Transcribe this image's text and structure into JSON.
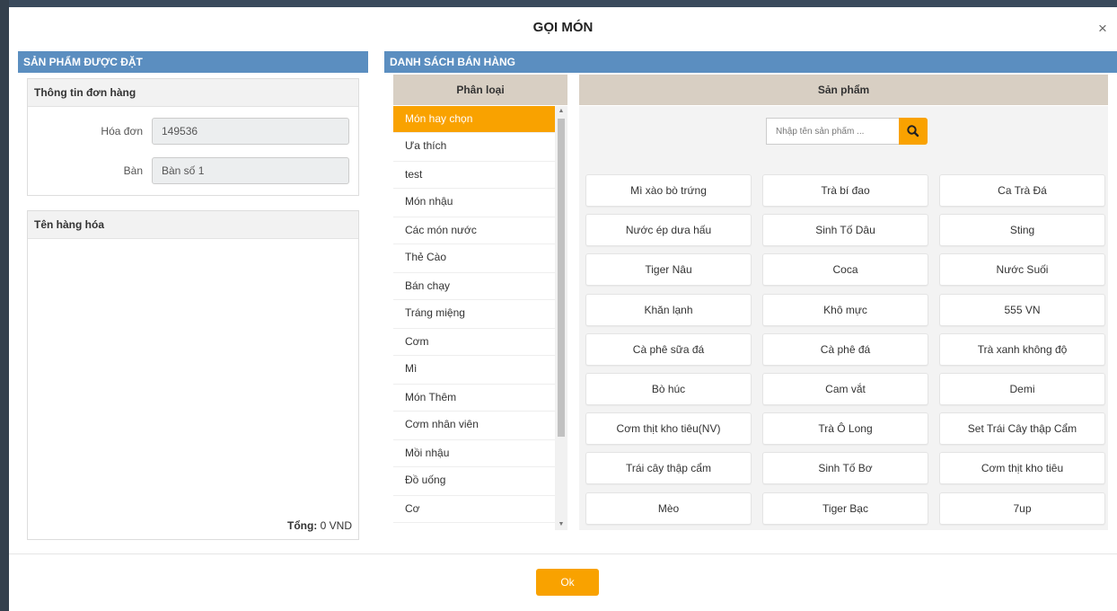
{
  "modal": {
    "title": "GỌI MÓN",
    "close_label": "×"
  },
  "left_panel": {
    "header": "SẢN PHẨM ĐƯỢC ĐẶT",
    "order_info": {
      "title": "Thông tin đơn hàng",
      "invoice_label": "Hóa đơn",
      "invoice_value": "149536",
      "table_label": "Bàn",
      "table_value": "Bàn số 1"
    },
    "items": {
      "title": "Tên hàng hóa",
      "total_label": "Tổng:",
      "total_value": "0 VND"
    }
  },
  "right_panel": {
    "header": "DANH SÁCH BÁN HÀNG",
    "category_header": "Phân loại",
    "product_header": "Sản phẩm",
    "search_placeholder": "Nhập tên sản phẩm ...",
    "categories": [
      "Món hay chọn",
      "Ưa thích",
      "test",
      "Món nhậu",
      "Các món nước",
      "Thẻ Cào",
      "Bán chạy",
      "Tráng miệng",
      "Cơm",
      "Mì",
      "Món Thêm",
      "Cơm nhân viên",
      "Mồi nhậu",
      "Đồ uống",
      "Cơ"
    ],
    "active_category": 0,
    "products": [
      "Mì xào bò trứng",
      "Trà bí đao",
      "Ca Trà Đá",
      "Nước ép dưa hấu",
      "Sinh Tố Dâu",
      "Sting",
      "Tiger Nâu",
      "Coca",
      "Nước Suối",
      "Khăn lạnh",
      "Khô mực",
      "555 VN",
      "Cà phê sữa đá",
      "Cà phê đá",
      "Trà xanh không độ",
      "Bò húc",
      "Cam vắt",
      "Demi",
      "Cơm thịt kho tiêu(NV)",
      "Trà Ô Long",
      "Set Trái Cây thập Cẩm",
      "Trái cây thập cẩm",
      "Sinh Tố Bơ",
      "Cơm thịt kho tiêu",
      "Mèo",
      "Tiger Bạc",
      "7up"
    ]
  },
  "footer": {
    "ok_label": "Ok"
  },
  "colors": {
    "header_blue": "#5b8ec0",
    "accent_orange": "#f9a200",
    "column_header": "#d8cfc3"
  }
}
